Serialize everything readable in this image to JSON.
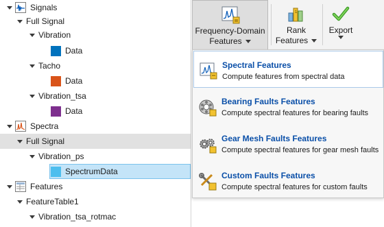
{
  "tree": {
    "signals": {
      "label": "Signals",
      "icon": "signals-icon"
    },
    "full_signal_1": {
      "label": "Full Signal"
    },
    "vibration": {
      "label": "Vibration"
    },
    "vibration_data": {
      "label": "Data",
      "color": "#0072bd"
    },
    "tacho": {
      "label": "Tacho"
    },
    "tacho_data": {
      "label": "Data",
      "color": "#d95319"
    },
    "vibration_tsa": {
      "label": "Vibration_tsa"
    },
    "vibration_tsa_data": {
      "label": "Data",
      "color": "#7e2f8e"
    },
    "spectra": {
      "label": "Spectra",
      "icon": "spectra-icon"
    },
    "full_signal_2": {
      "label": "Full Signal"
    },
    "vibration_ps": {
      "label": "Vibration_ps"
    },
    "spectrum_data": {
      "label": "SpectrumData",
      "color": "#4dbeee"
    },
    "features": {
      "label": "Features",
      "icon": "features-icon"
    },
    "feature_table": {
      "label": "FeatureTable1"
    },
    "vibration_tsa_rotmac": {
      "label": "Vibration_tsa_rotmac"
    }
  },
  "toolstrip": {
    "freq": {
      "line1": "Frequency-Domain",
      "line2": "Features",
      "icon": "frequency-domain-icon"
    },
    "rank": {
      "line1": "Rank",
      "line2": "Features",
      "icon": "rank-icon"
    },
    "export": {
      "line1": "Export",
      "icon": "export-checkmark-icon"
    }
  },
  "menu": {
    "items": [
      {
        "title": "Spectral Features",
        "desc": "Compute features from spectral data",
        "icon": "spectral-features-icon"
      },
      {
        "title": "Bearing Faults Features",
        "desc": "Compute spectral features for bearing faults",
        "icon": "bearing-icon"
      },
      {
        "title": "Gear Mesh Faults Features",
        "desc": "Compute spectral features for gear mesh faults",
        "icon": "gear-icon"
      },
      {
        "title": "Custom Faults Features",
        "desc": "Compute spectral features for custom faults",
        "icon": "tools-icon"
      }
    ]
  },
  "colors": {
    "accent": "#0a4fa8",
    "selection": "#c4e4f8"
  }
}
